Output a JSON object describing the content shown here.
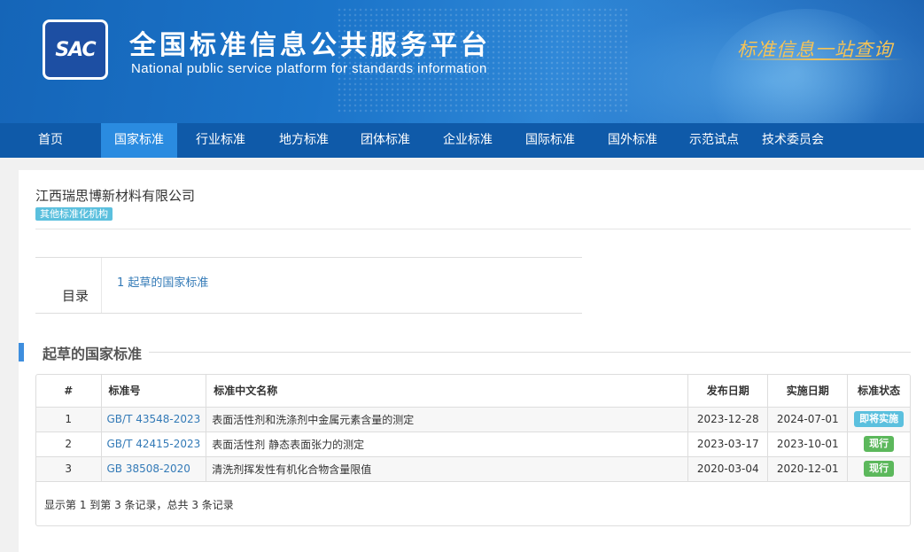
{
  "header": {
    "logo_text": "SAC",
    "title": "全国标准信息公共服务平台",
    "subtitle": "National public service platform  for standards information",
    "slogan": "标准信息一站查询"
  },
  "nav": [
    {
      "label": "首页",
      "active": false
    },
    {
      "label": "国家标准",
      "active": true
    },
    {
      "label": "行业标准",
      "active": false
    },
    {
      "label": "地方标准",
      "active": false
    },
    {
      "label": "团体标准",
      "active": false
    },
    {
      "label": "企业标准",
      "active": false
    },
    {
      "label": "国际标准",
      "active": false
    },
    {
      "label": "国外标准",
      "active": false
    },
    {
      "label": "示范试点",
      "active": false
    },
    {
      "label": "技术委员会",
      "active": false
    }
  ],
  "org": {
    "name": "江西瑞思博新材料有限公司",
    "tag": "其他标准化机构"
  },
  "toc": {
    "label": "目录",
    "items": [
      "1  起草的国家标准"
    ]
  },
  "section": {
    "title": "起草的国家标准"
  },
  "table": {
    "headers": [
      "#",
      "标准号",
      "标准中文名称",
      "发布日期",
      "实施日期",
      "标准状态"
    ],
    "rows": [
      {
        "idx": "1",
        "code": "GB/T 43548-2023",
        "name": "表面活性剂和洗涤剂中金属元素含量的测定",
        "publish": "2023-12-28",
        "implement": "2024-07-01",
        "status": "即将实施",
        "status_type": "info"
      },
      {
        "idx": "2",
        "code": "GB/T 42415-2023",
        "name": "表面活性剂 静态表面张力的测定",
        "publish": "2023-03-17",
        "implement": "2023-10-01",
        "status": "现行",
        "status_type": "ok"
      },
      {
        "idx": "3",
        "code": "GB 38508-2020",
        "name": "清洗剂挥发性有机化合物含量限值",
        "publish": "2020-03-04",
        "implement": "2020-12-01",
        "status": "现行",
        "status_type": "ok"
      }
    ],
    "pager_info": "显示第 1 到第 3 条记录，总共 3 条记录"
  },
  "colors": {
    "nav_bg": "#0f5aa9",
    "nav_active": "#2a8be0",
    "link": "#337ab7",
    "badge_info": "#5bc0de",
    "badge_ok": "#5cb85c"
  }
}
